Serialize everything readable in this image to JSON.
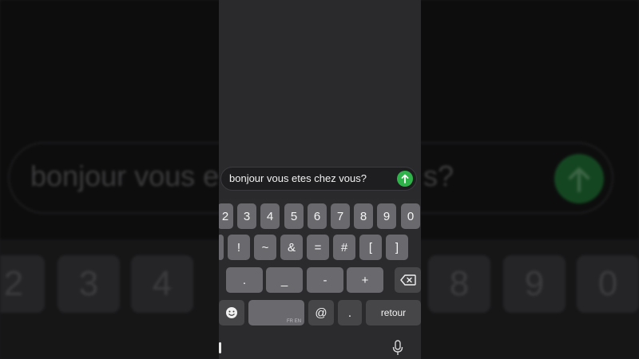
{
  "background": {
    "message_left": "bonjour vous e",
    "message_right": "s?",
    "number_keys_left": [
      "2",
      "3",
      "4"
    ],
    "number_keys_right": [
      "8",
      "9",
      "0"
    ]
  },
  "composer": {
    "message_text": "bonjour vous etes chez vous?",
    "send_icon": "arrow-up-icon",
    "send_color": "#2fb24a"
  },
  "keyboard": {
    "row_numbers": [
      "2",
      "3",
      "4",
      "5",
      "6",
      "7",
      "8",
      "9",
      "0"
    ],
    "row_symbols": [
      "!",
      "~",
      "&",
      "=",
      "#",
      "[",
      "]"
    ],
    "row_punct": [
      ".",
      "_",
      "-",
      "+"
    ],
    "bottom": {
      "emoji_icon": "emoji-icon",
      "space_sublabel": "FR EN",
      "at_label": "@",
      "dot_label": ".",
      "return_label": "retour"
    },
    "delete_icon": "backspace-icon",
    "mic_icon": "microphone-icon"
  }
}
